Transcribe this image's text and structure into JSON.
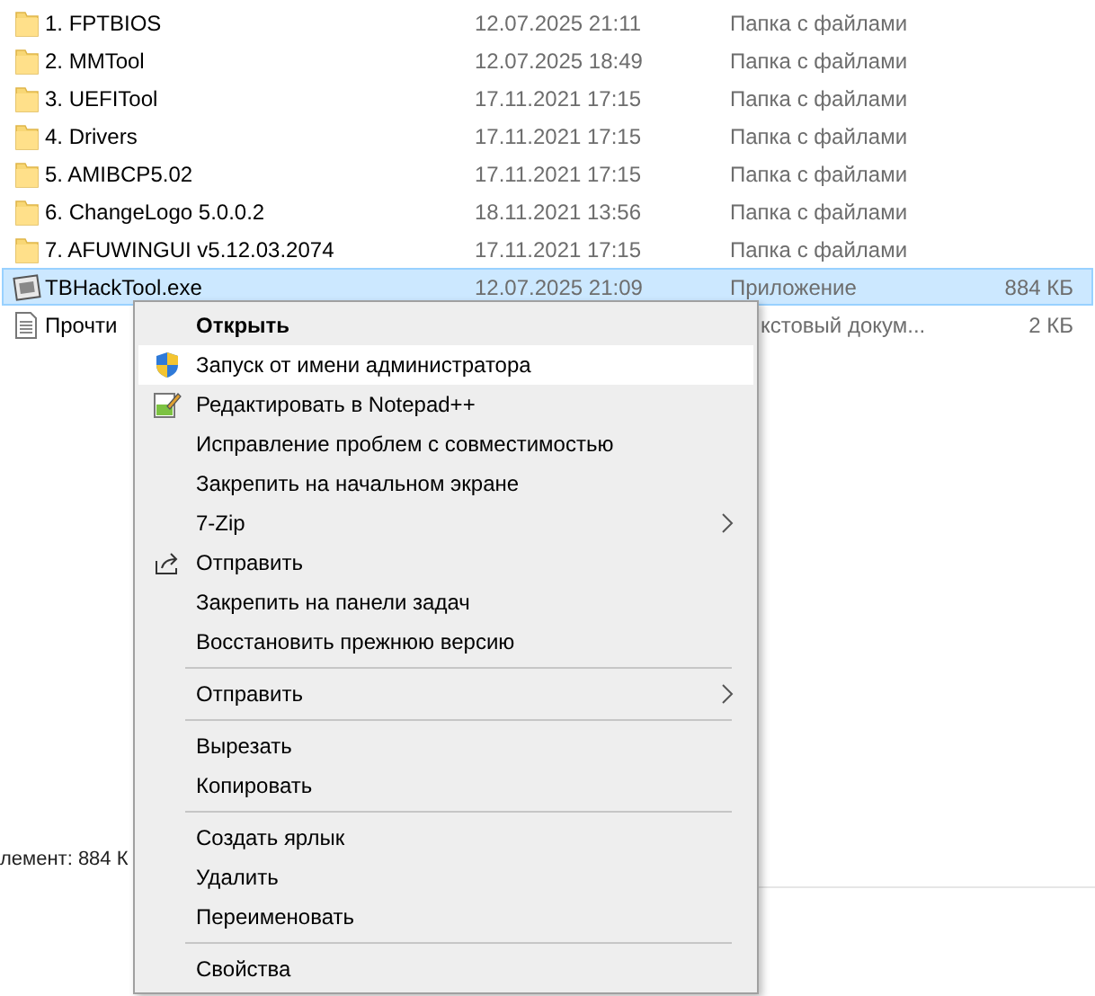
{
  "files": [
    {
      "kind": "folder",
      "name": "1. FPTBIOS",
      "date": "12.07.2025 21:11",
      "type": "Папка с файлами",
      "selected": false
    },
    {
      "kind": "folder",
      "name": "2. MMTool",
      "date": "12.07.2025 18:49",
      "type": "Папка с файлами",
      "selected": false
    },
    {
      "kind": "folder",
      "name": "3. UEFITool",
      "date": "17.11.2021 17:15",
      "type": "Папка с файлами",
      "selected": false
    },
    {
      "kind": "folder",
      "name": "4. Drivers",
      "date": "17.11.2021 17:15",
      "type": "Папка с файлами",
      "selected": false
    },
    {
      "kind": "folder",
      "name": "5. AMIBCP5.02",
      "date": "17.11.2021 17:15",
      "type": "Папка с файлами",
      "selected": false
    },
    {
      "kind": "folder",
      "name": "6. ChangeLogo 5.0.0.2",
      "date": "18.11.2021 13:56",
      "type": "Папка с файлами",
      "selected": false
    },
    {
      "kind": "folder",
      "name": "7. AFUWINGUI v5.12.03.2074",
      "date": "17.11.2021 17:15",
      "type": "Папка с файлами",
      "selected": false
    },
    {
      "kind": "app",
      "name": "TBHackTool.exe",
      "date": "12.07.2025 21:09",
      "type": "Приложение",
      "size": "884 КБ",
      "selected": true
    },
    {
      "kind": "text",
      "name": "Прочти",
      "type_tail": "кстовый докум...",
      "size": "2 КБ",
      "selected": false
    }
  ],
  "status_bar": {
    "text": "лемент: 884 К"
  },
  "context_menu": [
    {
      "kind": "item",
      "label": "Открыть",
      "bold": true,
      "selected": false
    },
    {
      "kind": "uac",
      "label": "Запуск от имени администратора",
      "selected": true
    },
    {
      "kind": "editor",
      "label": "Редактировать в Notepad++",
      "selected": false
    },
    {
      "kind": "item",
      "label": "Исправление проблем с совместимостью",
      "selected": false
    },
    {
      "kind": "item",
      "label": "Закрепить на начальном экране",
      "selected": false
    },
    {
      "kind": "item",
      "label": "7-Zip",
      "submenu": true,
      "selected": false
    },
    {
      "kind": "share",
      "label": "Отправить",
      "selected": false
    },
    {
      "kind": "item",
      "label": "Закрепить на панели задач",
      "selected": false
    },
    {
      "kind": "item",
      "label": "Восстановить прежнюю версию",
      "selected": false
    },
    {
      "kind": "separator"
    },
    {
      "kind": "item",
      "label": "Отправить",
      "submenu": true,
      "selected": false
    },
    {
      "kind": "separator"
    },
    {
      "kind": "item",
      "label": "Вырезать",
      "selected": false
    },
    {
      "kind": "item",
      "label": "Копировать",
      "selected": false
    },
    {
      "kind": "separator"
    },
    {
      "kind": "item",
      "label": "Создать ярлык",
      "selected": false
    },
    {
      "kind": "item",
      "label": "Удалить",
      "selected": false
    },
    {
      "kind": "item",
      "label": "Переименовать",
      "selected": false
    },
    {
      "kind": "separator"
    },
    {
      "kind": "item",
      "label": "Свойства",
      "selected": false
    }
  ]
}
